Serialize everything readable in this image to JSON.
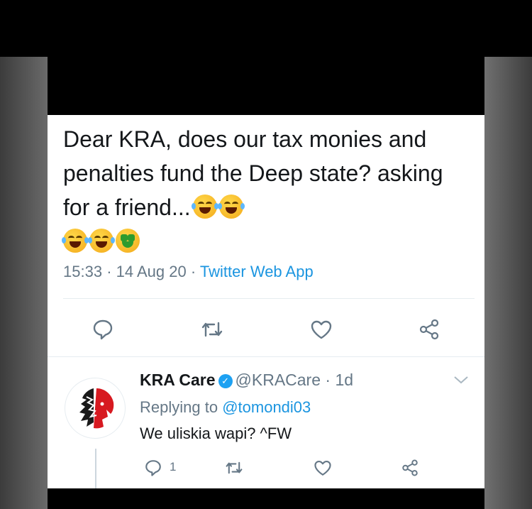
{
  "tweet": {
    "text": "Dear KRA, does our tax monies and penalties fund the Deep state? asking for a friend...",
    "time": "15:33",
    "date": "14 Aug 20",
    "source": "Twitter Web App",
    "sep": "·"
  },
  "reply": {
    "name": "KRA Care",
    "handle": "@KRACare",
    "age": "1d",
    "replying_label": "Replying to",
    "replying_handle": "@tomondi03",
    "text": "We uliskia wapi? ^FW",
    "reply_count": "1"
  },
  "colors": {
    "link": "#1b95e0",
    "muted": "#657786",
    "text": "#14171a",
    "verified": "#1da1f2"
  },
  "icons": [
    "reply-icon",
    "retweet-icon",
    "like-icon",
    "share-icon",
    "verified-badge-icon",
    "chevron-down-icon"
  ]
}
